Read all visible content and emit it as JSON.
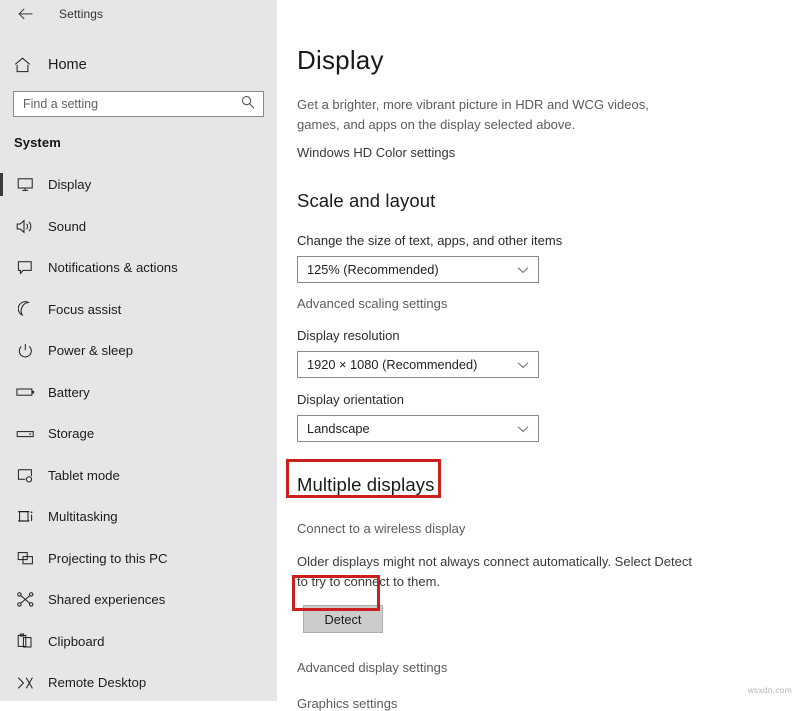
{
  "window": {
    "back_icon": "back-arrow-icon",
    "title": "Settings"
  },
  "sidebar": {
    "home": {
      "label": "Home",
      "icon": "home-icon"
    },
    "search": {
      "placeholder": "Find a setting",
      "value": "",
      "icon": "search-icon"
    },
    "group_title": "System",
    "items": [
      {
        "label": "Display",
        "icon": "monitor-icon",
        "selected": true
      },
      {
        "label": "Sound",
        "icon": "speaker-icon",
        "selected": false
      },
      {
        "label": "Notifications & actions",
        "icon": "notification-icon",
        "selected": false
      },
      {
        "label": "Focus assist",
        "icon": "moon-icon",
        "selected": false
      },
      {
        "label": "Power & sleep",
        "icon": "power-icon",
        "selected": false
      },
      {
        "label": "Battery",
        "icon": "battery-icon",
        "selected": false
      },
      {
        "label": "Storage",
        "icon": "storage-icon",
        "selected": false
      },
      {
        "label": "Tablet mode",
        "icon": "tablet-icon",
        "selected": false
      },
      {
        "label": "Multitasking",
        "icon": "multitasking-icon",
        "selected": false
      },
      {
        "label": "Projecting to this PC",
        "icon": "projecting-icon",
        "selected": false
      },
      {
        "label": "Shared experiences",
        "icon": "share-icon",
        "selected": false
      },
      {
        "label": "Clipboard",
        "icon": "clipboard-icon",
        "selected": false
      },
      {
        "label": "Remote Desktop",
        "icon": "remote-desktop-icon",
        "selected": false
      }
    ]
  },
  "main": {
    "page_title": "Display",
    "hdr_description": "Get a brighter, more vibrant picture in HDR and WCG videos, games, and apps on the display selected above.",
    "hd_color_link": "Windows HD Color settings",
    "scale_section": {
      "heading": "Scale and layout",
      "scale_label": "Change the size of text, apps, and other items",
      "scale_value": "125% (Recommended)",
      "advanced_scaling_link": "Advanced scaling settings",
      "resolution_label": "Display resolution",
      "resolution_value": "1920 × 1080 (Recommended)",
      "orientation_label": "Display orientation",
      "orientation_value": "Landscape"
    },
    "multiple_displays": {
      "heading": "Multiple displays",
      "wireless_link": "Connect to a wireless display",
      "detect_description": "Older displays might not always connect automatically. Select Detect to try to connect to them.",
      "detect_button": "Detect"
    },
    "footer_links": [
      "Advanced display settings",
      "Graphics settings"
    ]
  },
  "annotations": {
    "color": "#cc1f1f",
    "targets": [
      "multiple-displays-heading",
      "detect-button"
    ]
  },
  "watermark": "wsxdn.com"
}
